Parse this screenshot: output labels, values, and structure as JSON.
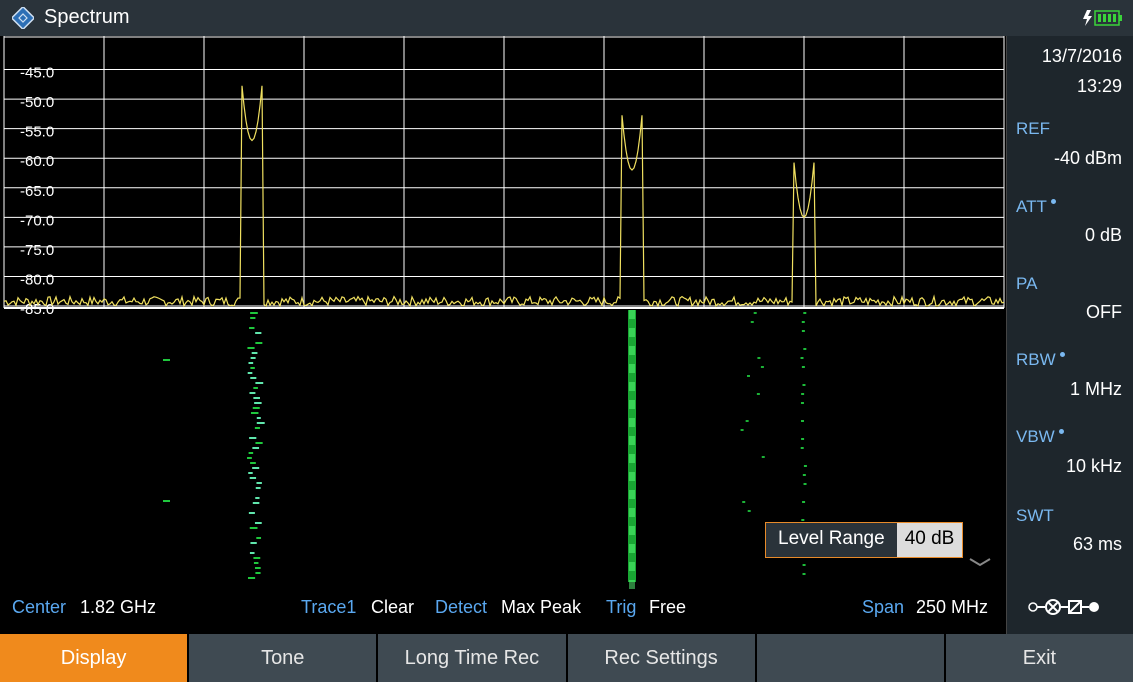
{
  "app": {
    "title": "Spectrum",
    "logo_icon": "rohde-schwarz-diamond-icon",
    "battery_icon": "charging-battery-icon"
  },
  "side_panel": {
    "date": "13/7/2016",
    "time": "13:29",
    "params": [
      {
        "label": "REF",
        "value": "-40 dBm",
        "dot": false
      },
      {
        "label": "ATT",
        "value": "0 dB",
        "dot": true
      },
      {
        "label": "PA",
        "value": "OFF",
        "dot": false
      },
      {
        "label": "RBW",
        "value": "1 MHz",
        "dot": true
      },
      {
        "label": "VBW",
        "value": "10 kHz",
        "dot": true
      },
      {
        "label": "SWT",
        "value": "63 ms",
        "dot": false
      }
    ],
    "connector_icon": "connector-status-icon"
  },
  "status": {
    "center_label": "Center",
    "center_value": "1.82 GHz",
    "trace_label": "Trace1",
    "trace_value": "Clear",
    "detect_label": "Detect",
    "detect_value": "Max Peak",
    "trig_label": "Trig",
    "trig_value": "Free",
    "span_label": "Span",
    "span_value": "250 MHz"
  },
  "level_range": {
    "label": "Level Range",
    "value": "40 dB"
  },
  "softkeys": [
    "Display",
    "Tone",
    "Long Time Rec",
    "Rec Settings",
    "",
    "Exit"
  ],
  "active_softkey": 0,
  "colors": {
    "trace": "#f0e060",
    "spectrogram": "#22dd44",
    "accent": "#f08a1c",
    "label_blue": "#5aa8f0"
  },
  "chart_data": {
    "type": "line",
    "y_tick_labels": [
      "-45.0",
      "-50.0",
      "-55.0",
      "-60.0",
      "-65.0",
      "-70.0",
      "-75.0",
      "-80.0",
      "-85.0"
    ],
    "ylim": [
      -85,
      -40
    ],
    "xlim": [
      1.695,
      1.945
    ],
    "grid": true,
    "noise_floor": -84.2,
    "peaks": [
      {
        "x": 1.757,
        "y": -57
      },
      {
        "x": 1.852,
        "y": -62
      },
      {
        "x": 1.895,
        "y": -70
      }
    ]
  }
}
